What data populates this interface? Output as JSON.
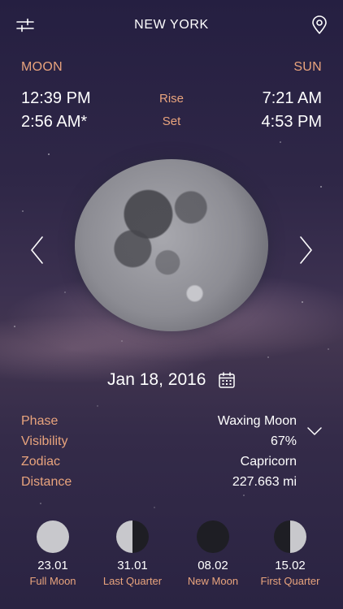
{
  "header": {
    "city": "NEW YORK",
    "settings_icon": "sliders-icon",
    "location_icon": "map-pin-icon"
  },
  "rise_set": {
    "moon_heading": "MOON",
    "sun_heading": "SUN",
    "rise_label": "Rise",
    "set_label": "Set",
    "moon_rise": "12:39 PM",
    "moon_set": "2:56 AM*",
    "sun_rise": "7:21 AM",
    "sun_set": "4:53 PM"
  },
  "date": {
    "label": "Jan 18, 2016",
    "calendar_icon": "calendar-icon"
  },
  "details": {
    "phase_label": "Phase",
    "phase_value": "Waxing Moon",
    "visibility_label": "Visibility",
    "visibility_value": "67%",
    "zodiac_label": "Zodiac",
    "zodiac_value": "Capricorn",
    "distance_label": "Distance",
    "distance_value": "227.663 mi"
  },
  "upcoming": [
    {
      "date": "23.01",
      "name": "Full Moon",
      "icon": "full-moon-icon"
    },
    {
      "date": "31.01",
      "name": "Last Quarter",
      "icon": "last-quarter-icon"
    },
    {
      "date": "08.02",
      "name": "New Moon",
      "icon": "new-moon-icon"
    },
    {
      "date": "15.02",
      "name": "First Quarter",
      "icon": "first-quarter-icon"
    }
  ],
  "colors": {
    "accent": "#e9a47d",
    "background_top": "#251f41",
    "background_band": "#433650",
    "moon_light": "#c8c8cc",
    "moon_dark": "#1e1e24"
  }
}
